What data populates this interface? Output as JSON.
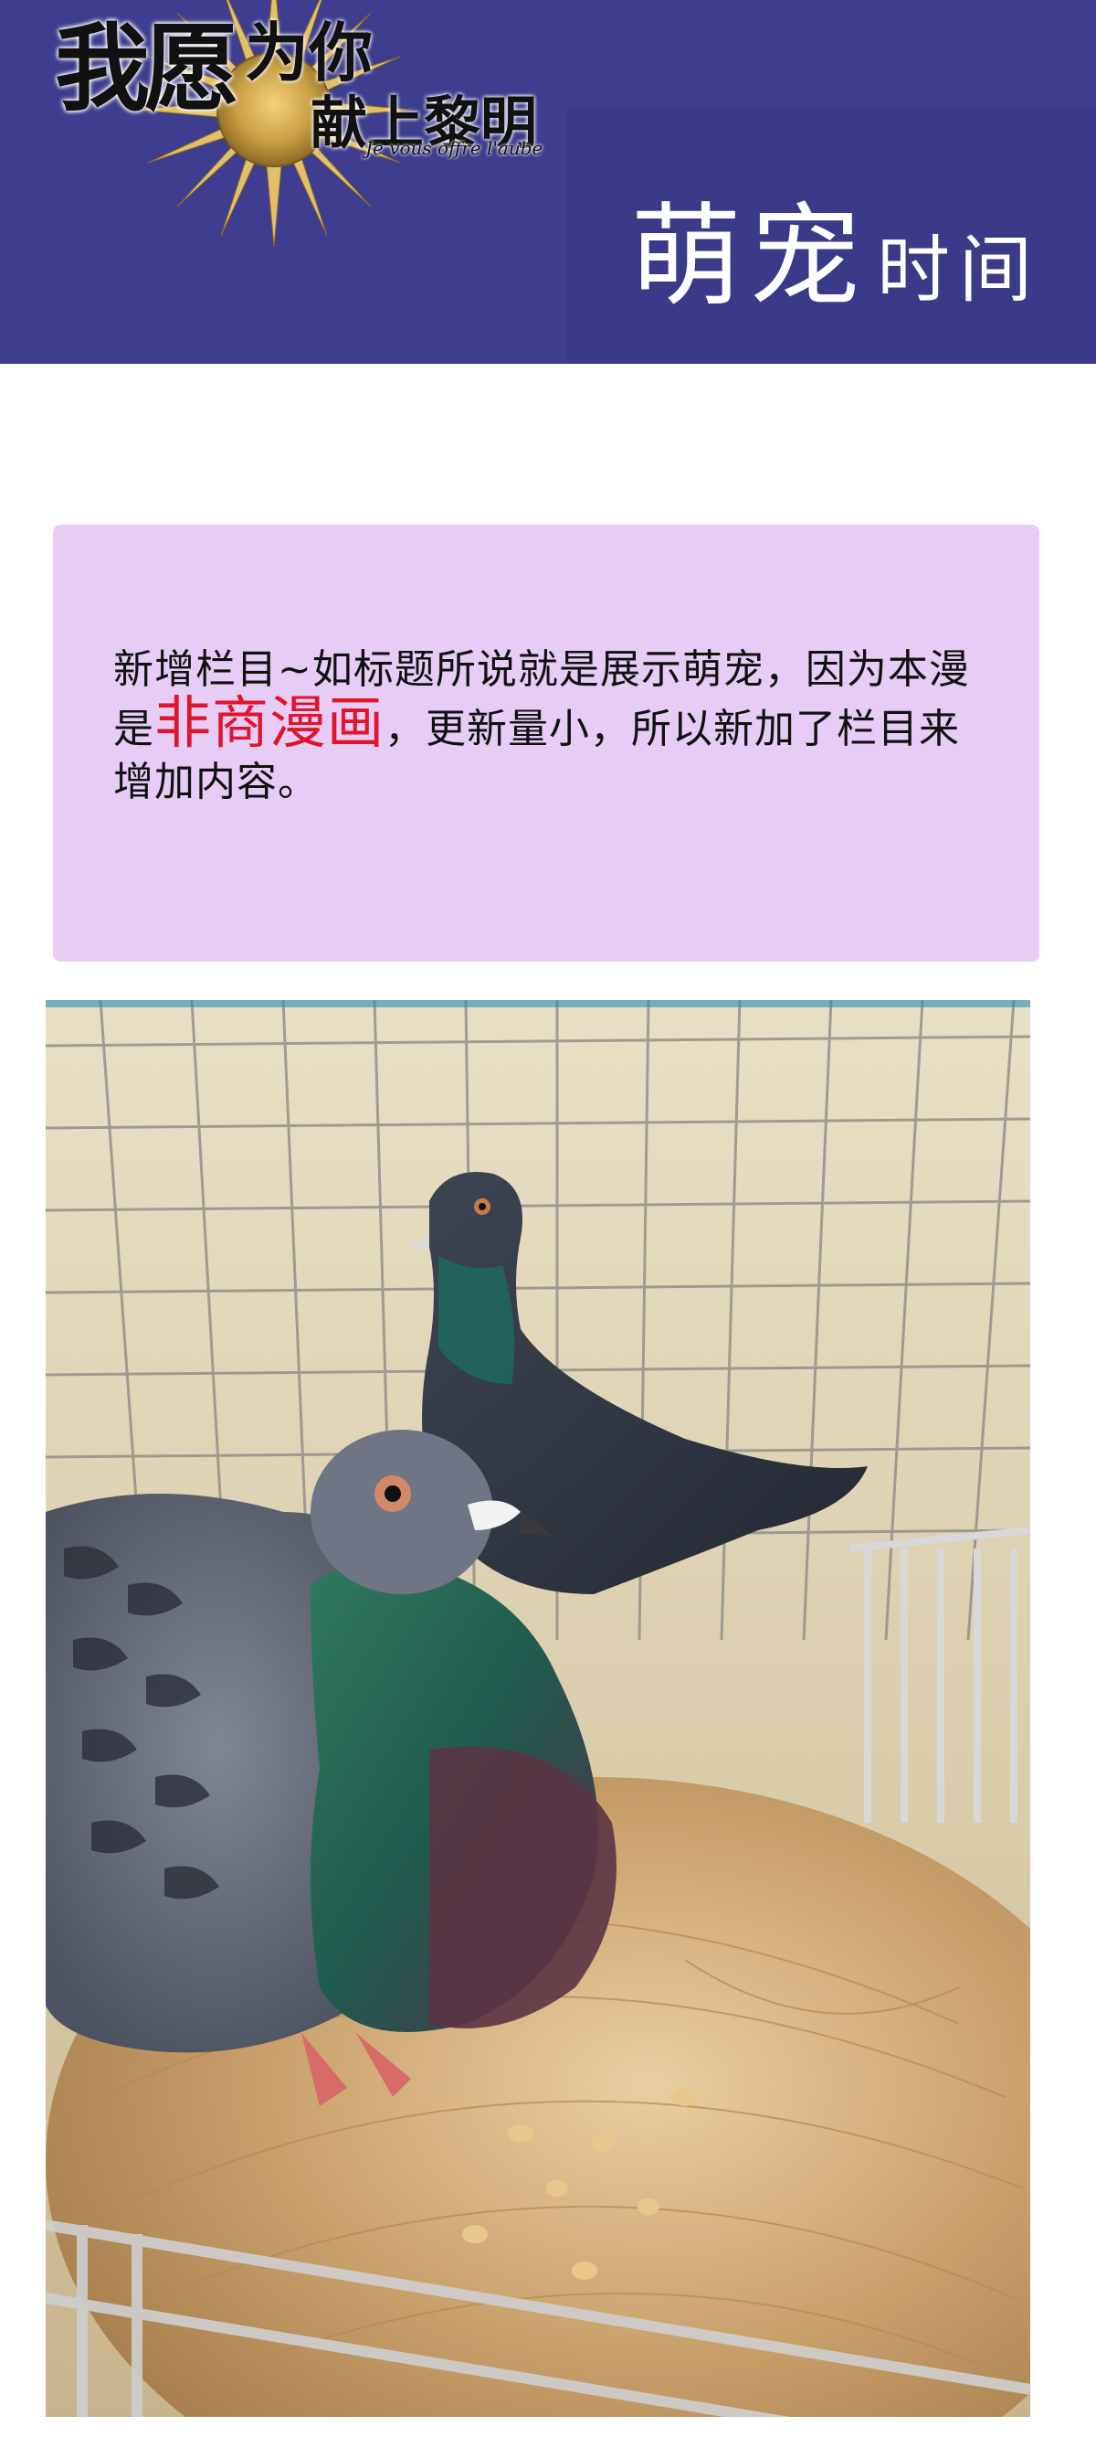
{
  "header": {
    "logo": {
      "line1": "我愿",
      "line1b": "为你",
      "line2": "献上黎明",
      "subtitle": "Je vous offre l'aube",
      "icon": "sun-emblem"
    },
    "title_big": "萌宠",
    "title_small": "时间",
    "background_color": "#3e3d8f"
  },
  "intro": {
    "text_before": "新增栏目~如标题所说就是展示萌宠，因为本漫是",
    "highlight": "非商漫画",
    "text_after": "，更新量小，所以新加了栏目来增加内容。",
    "card_color": "#e7cdf6",
    "highlight_color": "#e0142a"
  },
  "photo": {
    "subject": "two pigeons in a wire cage nest",
    "icon": "pigeon-photo"
  }
}
